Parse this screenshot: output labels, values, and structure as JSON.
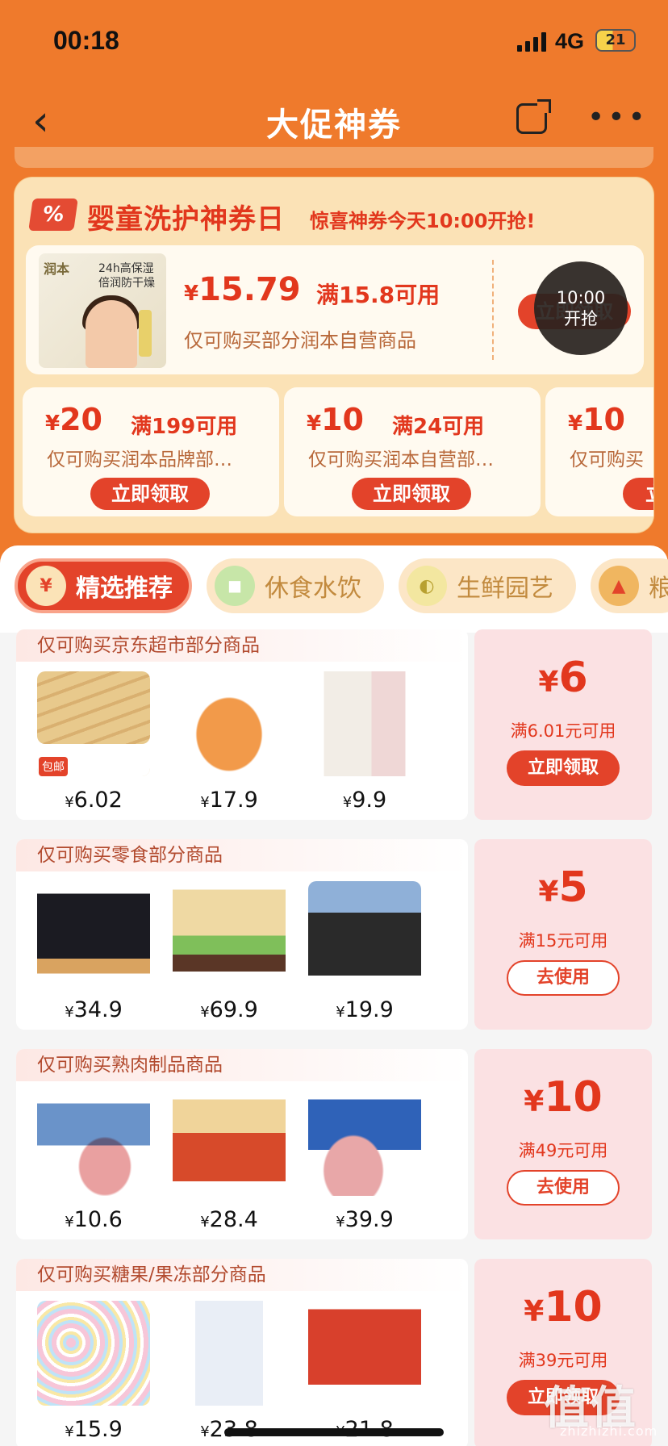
{
  "status": {
    "time": "00:18",
    "network": "4G",
    "battery": "21"
  },
  "nav": {
    "title": "大促神券"
  },
  "promo": {
    "badge": "%",
    "title": "婴童洗护神券日",
    "subtitle": "惊喜神券今天10:00开抢!",
    "main_coupon": {
      "product_brand": "润本",
      "product_text": "24h高保湿 倍润防干燥",
      "currency": "¥",
      "amount": "15.79",
      "condition": "满15.8可用",
      "desc": "仅可购买部分润本自营商品",
      "button": "立即领取",
      "timer_time": "10:00",
      "timer_label": "开抢"
    },
    "small_coupons": [
      {
        "currency": "¥",
        "amount": "20",
        "condition": "满199可用",
        "desc": "仅可购买润本品牌部…",
        "button": "立即领取"
      },
      {
        "currency": "¥",
        "amount": "10",
        "condition": "满24可用",
        "desc": "仅可购买润本自营部…",
        "button": "立即领取"
      },
      {
        "currency": "¥",
        "amount": "10",
        "condition": "",
        "desc": "仅可购买",
        "button": "立"
      }
    ]
  },
  "tabs": [
    {
      "label": "精选推荐",
      "icon": "coupon-icon",
      "active": true
    },
    {
      "label": "休食水饮",
      "icon": "snack-drink-icon",
      "active": false
    },
    {
      "label": "生鲜园艺",
      "icon": "fresh-produce-icon",
      "active": false
    },
    {
      "label": "粮",
      "icon": "grain-icon",
      "active": false
    }
  ],
  "cards": [
    {
      "header": "仅可购买京东超市部分商品",
      "items": [
        {
          "price": "6.02",
          "tag": "包邮"
        },
        {
          "price": "17.9"
        },
        {
          "price": "9.9"
        }
      ],
      "currency": "¥",
      "amount": "6",
      "condition": "满6.01元可用",
      "button": "立即领取",
      "button_style": "fill"
    },
    {
      "header": "仅可购买零食部分商品",
      "items": [
        {
          "price": "34.9"
        },
        {
          "price": "69.9"
        },
        {
          "price": "19.9"
        }
      ],
      "currency": "¥",
      "amount": "5",
      "condition": "满15元可用",
      "button": "去使用",
      "button_style": "line"
    },
    {
      "header": "仅可购买熟肉制品商品",
      "items": [
        {
          "price": "10.6"
        },
        {
          "price": "28.4"
        },
        {
          "price": "39.9"
        }
      ],
      "currency": "¥",
      "amount": "10",
      "condition": "满49元可用",
      "button": "去使用",
      "button_style": "line"
    },
    {
      "header": "仅可购买糖果/果冻部分商品",
      "items": [
        {
          "price": "15.9"
        },
        {
          "price": "23.8"
        },
        {
          "price": "21.8"
        }
      ],
      "currency": "¥",
      "amount": "10",
      "condition": "满39元可用",
      "button": "立即领取",
      "button_style": "fill"
    }
  ],
  "watermark": {
    "text": "值值值",
    "url": "zhizhizhi.com"
  },
  "colors": {
    "brand_orange": "#ef7a2c",
    "accent_red": "#e3432a",
    "coupon_bg": "#fbe1e3"
  }
}
